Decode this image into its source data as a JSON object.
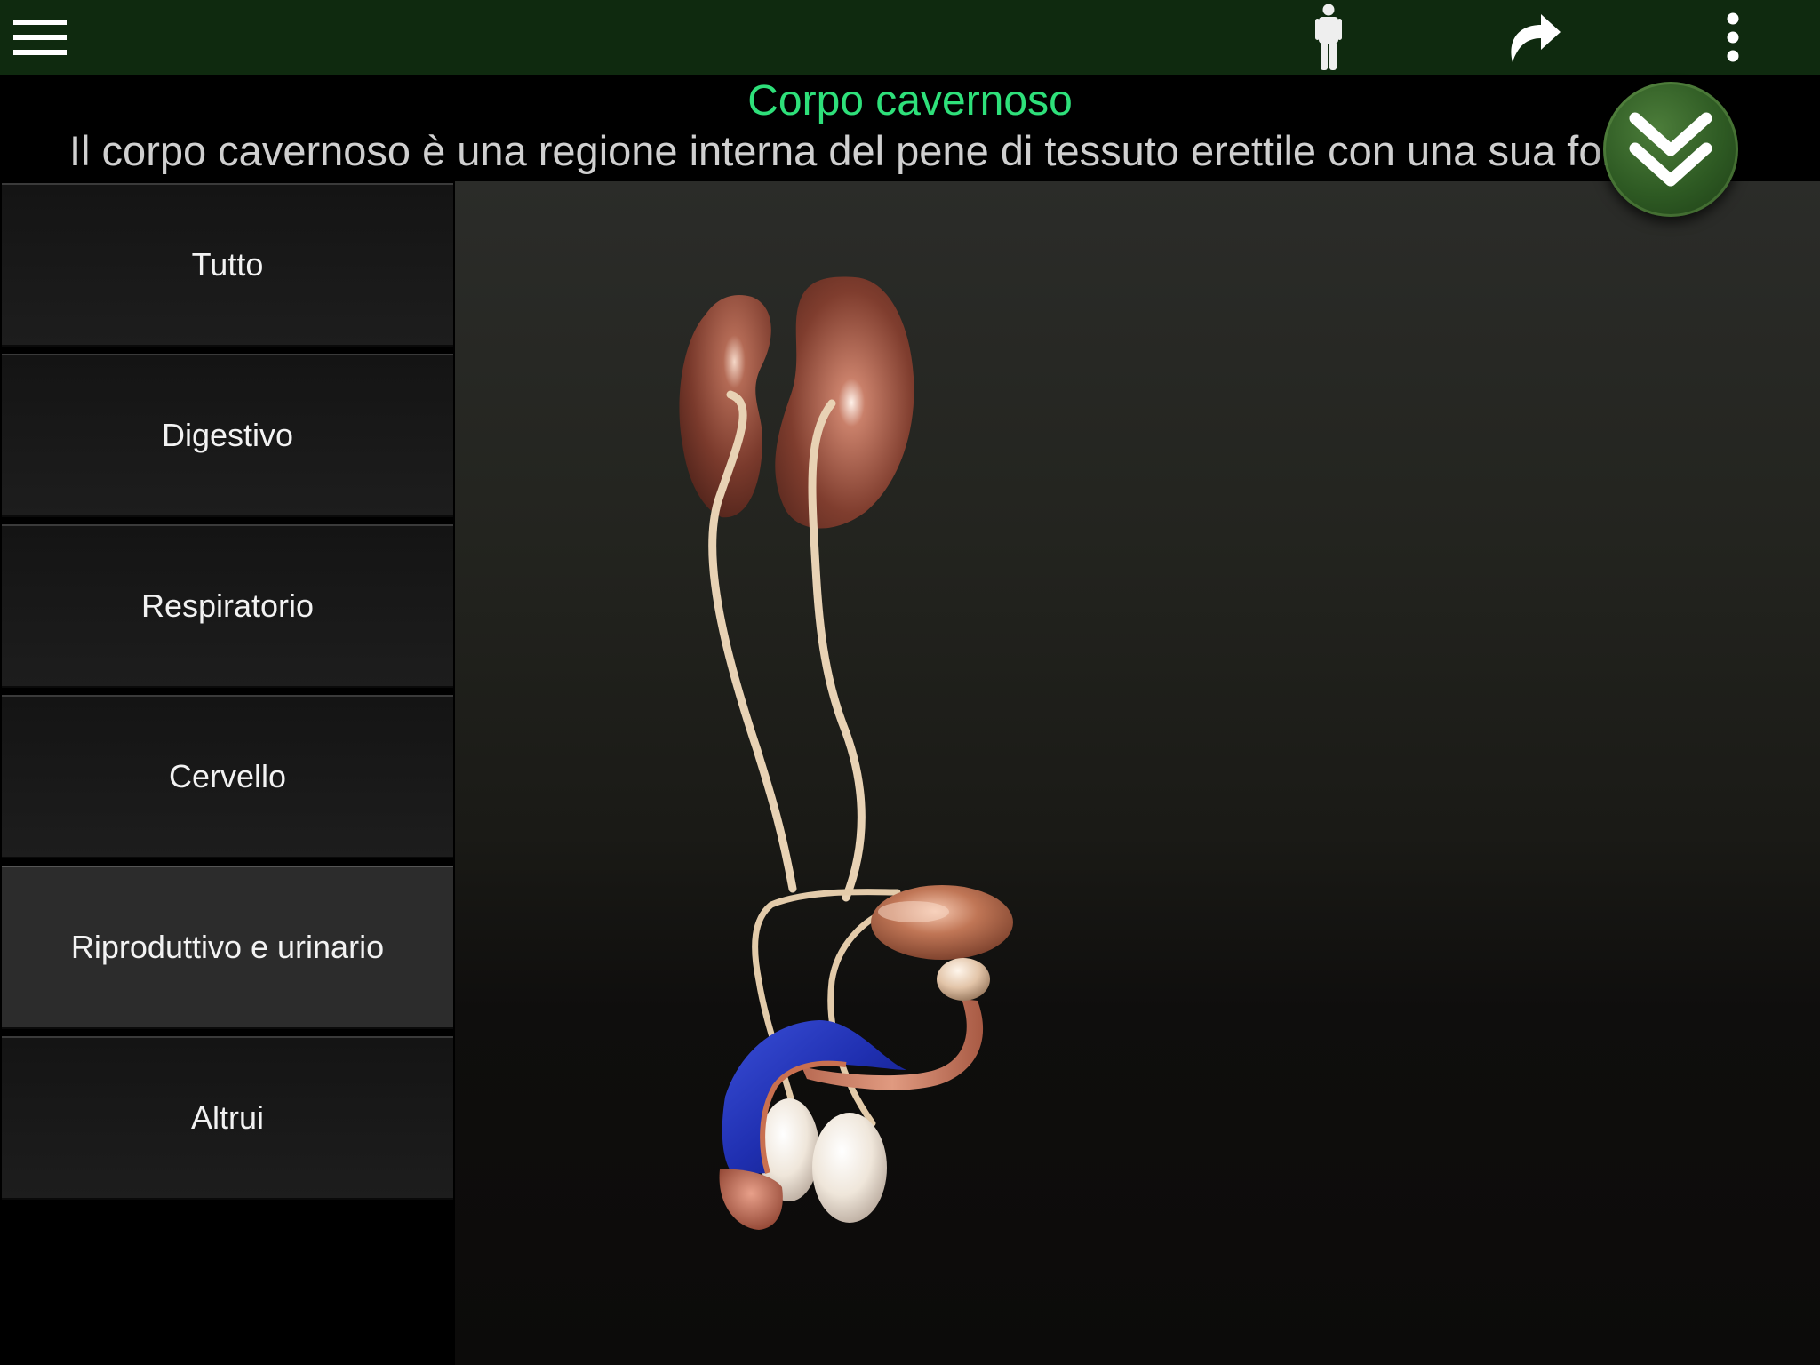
{
  "toolbar": {
    "menu_icon": "hamburger-menu-icon",
    "person_icon": "human-figure-icon",
    "redo_icon": "redo-arrow-icon",
    "more_icon": "more-vertical-icon"
  },
  "info": {
    "title": "Corpo cavernoso",
    "description": "Il corpo cavernoso è una regione interna del pene di tessuto erettile con una sua forma",
    "collapse_icon": "double-chevron-down-icon"
  },
  "sidebar": {
    "items": [
      {
        "label": "Tutto"
      },
      {
        "label": "Digestivo"
      },
      {
        "label": "Respiratorio"
      },
      {
        "label": "Cervello"
      },
      {
        "label": "Riproduttivo e urinario",
        "active": true
      },
      {
        "label": "Altrui"
      }
    ]
  },
  "colors": {
    "toolbar_bg": "#0f2a0f",
    "title": "#2ee07a",
    "description": "#cfcfcf"
  }
}
